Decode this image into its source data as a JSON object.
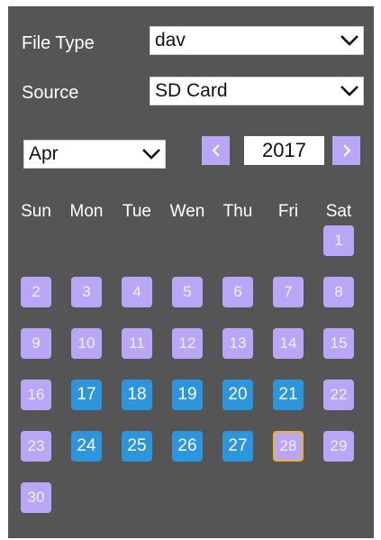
{
  "filters": {
    "file_type_label": "File Type",
    "file_type_value": "dav",
    "source_label": "Source",
    "source_value": "SD Card"
  },
  "calendar": {
    "month_value": "Apr",
    "prev_icon": "chevron-left-icon",
    "next_icon": "chevron-right-icon",
    "year": "2017",
    "weekdays": [
      "Sun",
      "Mon",
      "Tue",
      "Wen",
      "Thu",
      "Fri",
      "Sat"
    ],
    "first_weekday_index": 6,
    "days": [
      {
        "label": "1",
        "recorded": false
      },
      {
        "label": "2",
        "recorded": false
      },
      {
        "label": "3",
        "recorded": false
      },
      {
        "label": "4",
        "recorded": false
      },
      {
        "label": "5",
        "recorded": false
      },
      {
        "label": "6",
        "recorded": false
      },
      {
        "label": "7",
        "recorded": false
      },
      {
        "label": "8",
        "recorded": false
      },
      {
        "label": "9",
        "recorded": false
      },
      {
        "label": "10",
        "recorded": false
      },
      {
        "label": "11",
        "recorded": false
      },
      {
        "label": "12",
        "recorded": false
      },
      {
        "label": "13",
        "recorded": false
      },
      {
        "label": "14",
        "recorded": false
      },
      {
        "label": "15",
        "recorded": false
      },
      {
        "label": "16",
        "recorded": false
      },
      {
        "label": "17",
        "recorded": true
      },
      {
        "label": "18",
        "recorded": true
      },
      {
        "label": "19",
        "recorded": true
      },
      {
        "label": "20",
        "recorded": true
      },
      {
        "label": "21",
        "recorded": true
      },
      {
        "label": "22",
        "recorded": false
      },
      {
        "label": "23",
        "recorded": false
      },
      {
        "label": "24",
        "recorded": true
      },
      {
        "label": "25",
        "recorded": true
      },
      {
        "label": "26",
        "recorded": true
      },
      {
        "label": "27",
        "recorded": true
      },
      {
        "label": "28",
        "recorded": false,
        "selected": true
      },
      {
        "label": "29",
        "recorded": false
      },
      {
        "label": "30",
        "recorded": false
      }
    ]
  },
  "colors": {
    "panel_bg": "#555555",
    "day_inactive": "#b9a6f6",
    "day_recorded": "#2b95dd",
    "selected_border": "#f0b418"
  }
}
